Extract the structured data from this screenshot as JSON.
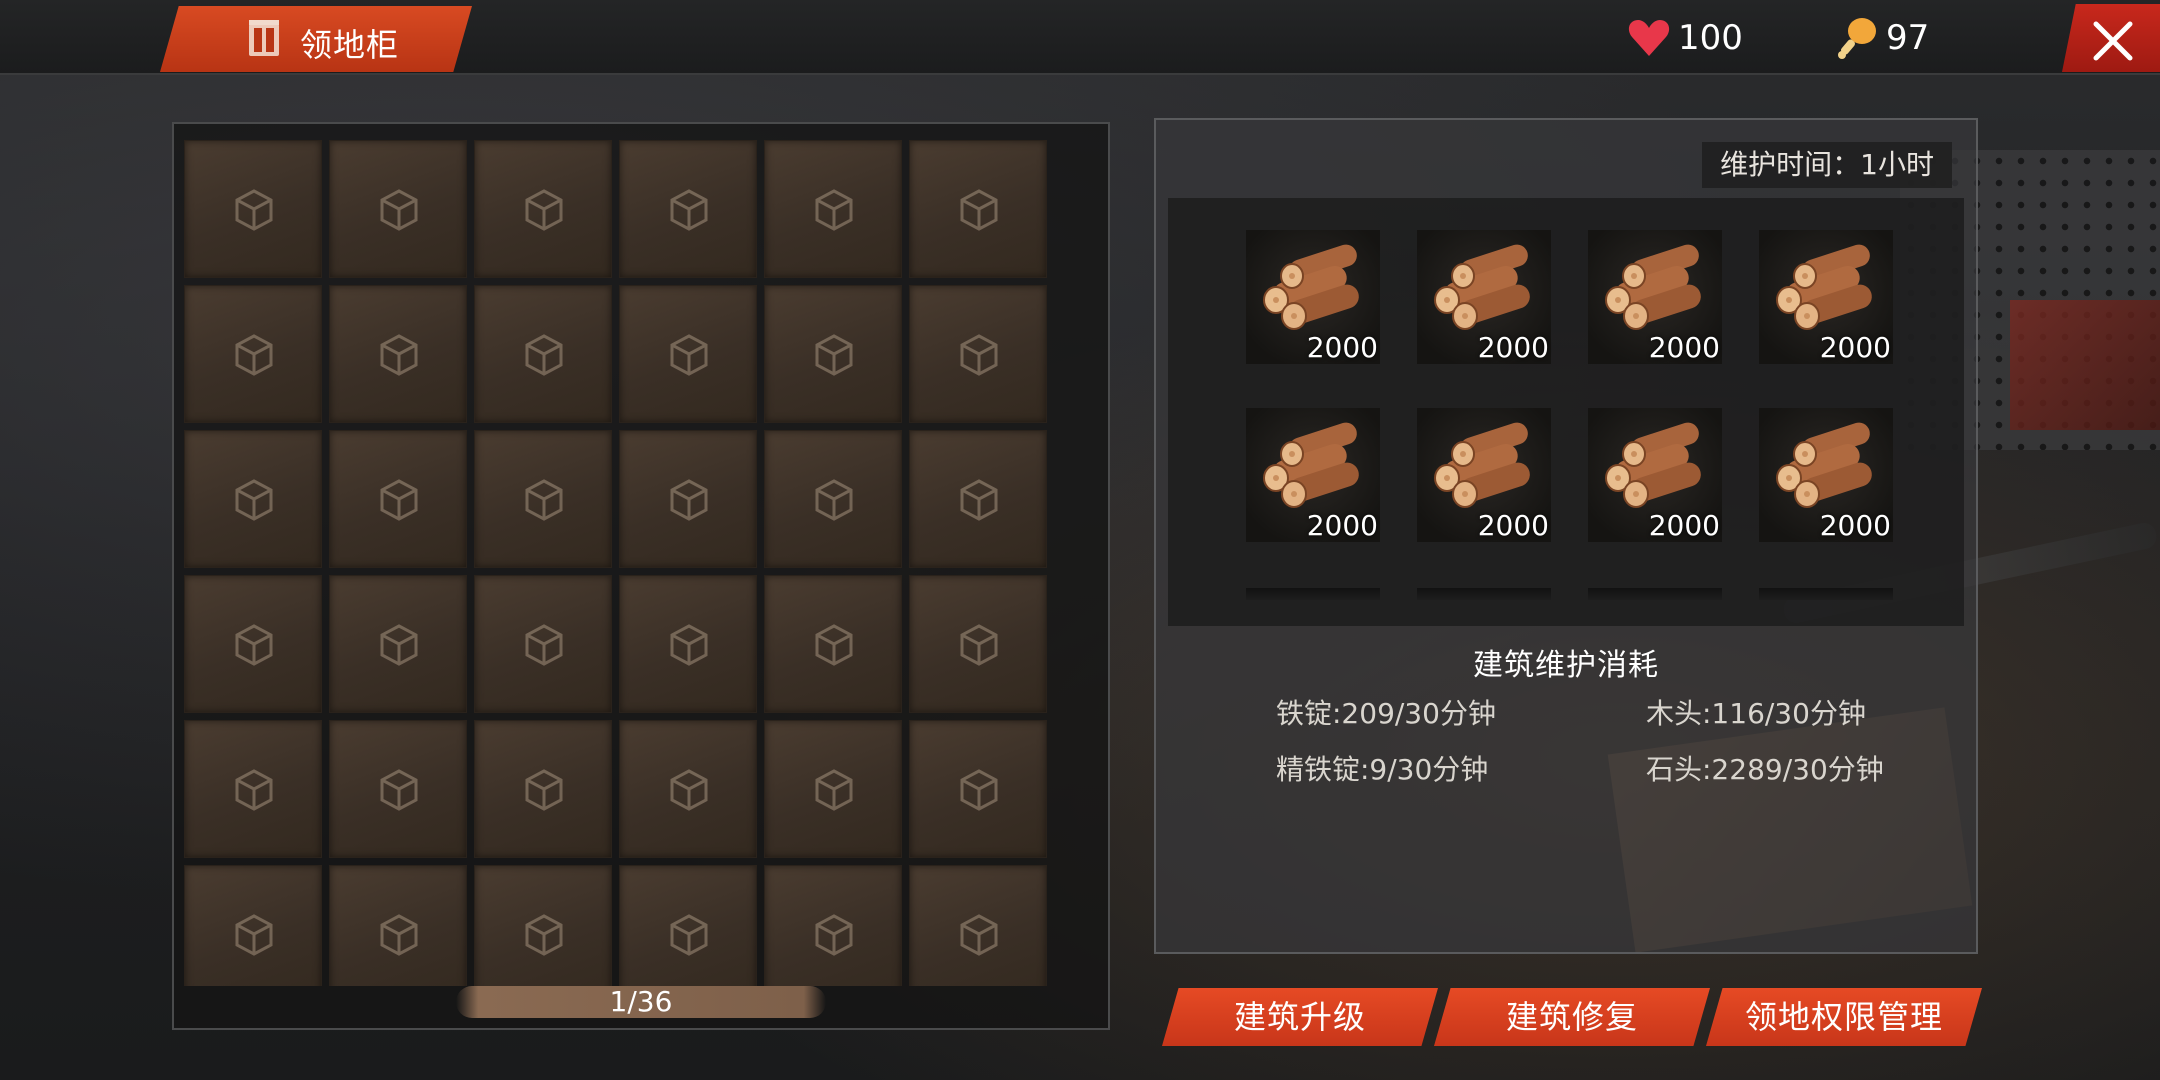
{
  "header": {
    "title": "领地柜",
    "title_icon": "cabinet-icon",
    "health_value": "100",
    "health_icon": "heart-icon",
    "food_value": "97",
    "food_icon": "drumstick-icon",
    "close_icon": "close-icon",
    "accent_color": "#d84a22"
  },
  "storage": {
    "slot_icon": "cube-icon",
    "slot_count_visible": 36,
    "pager": "1/36"
  },
  "maintenance": {
    "time_label": "维护时间：1小时",
    "items": [
      {
        "name": "wood-logs",
        "count": "2000"
      },
      {
        "name": "wood-logs",
        "count": "2000"
      },
      {
        "name": "wood-logs",
        "count": "2000"
      },
      {
        "name": "wood-logs",
        "count": "2000"
      },
      {
        "name": "wood-logs",
        "count": "2000"
      },
      {
        "name": "wood-logs",
        "count": "2000"
      },
      {
        "name": "wood-logs",
        "count": "2000"
      },
      {
        "name": "wood-logs",
        "count": "2000"
      }
    ],
    "cost_title": "建筑维护消耗",
    "costs": {
      "iron_ingot": "铁锭:209/30分钟",
      "wood": "木头:116/30分钟",
      "refined_iron": "精铁锭:9/30分钟",
      "stone": "石头:2289/30分钟"
    }
  },
  "actions": {
    "upgrade": "建筑升级",
    "repair": "建筑修复",
    "permissions": "领地权限管理"
  }
}
